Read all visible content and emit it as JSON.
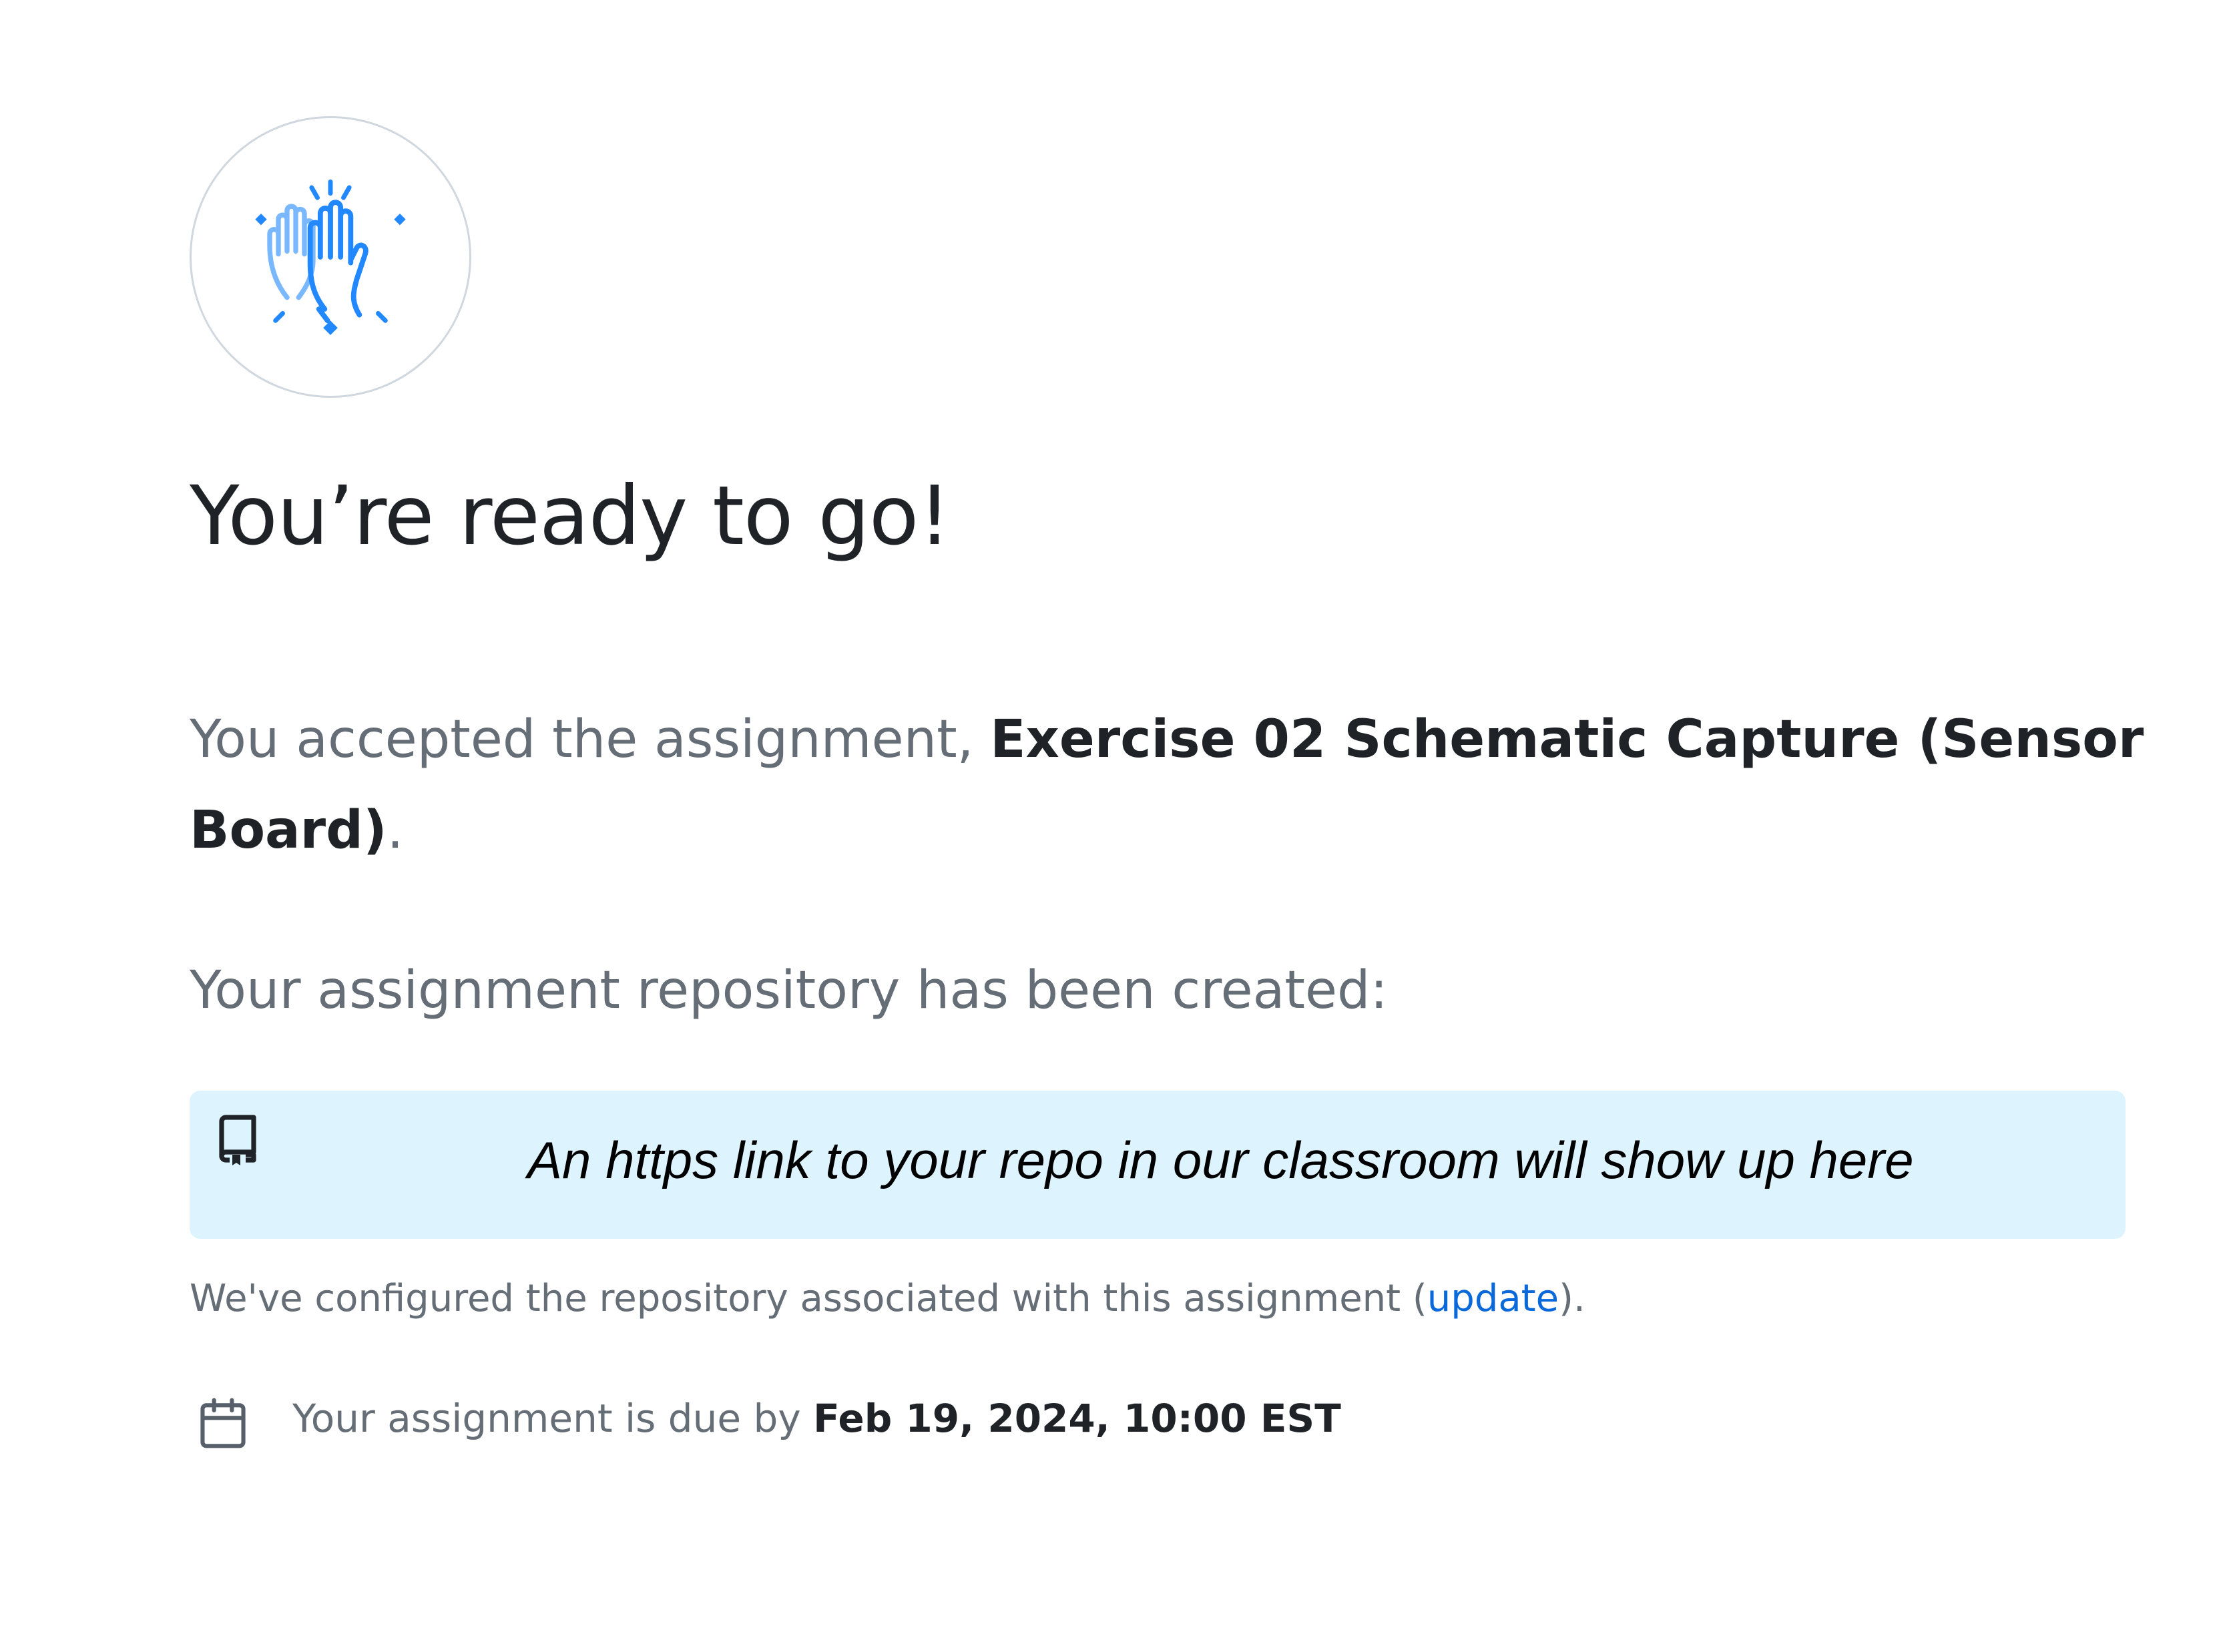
{
  "hero": {
    "icon": "high-five-icon",
    "colors": {
      "primary": "#2188ff",
      "light": "#79b8ff"
    }
  },
  "title": "You’re ready to go!",
  "accepted": {
    "prefix": "You accepted the assignment, ",
    "assignment_name": "Exercise 02 Schematic Capture (Sensor Board)",
    "suffix": "."
  },
  "repository": {
    "created_text": "Your assignment repository has been created:",
    "icon": "repo-icon",
    "link_text": "An https link to your repo in our classroom will show up here",
    "box_color": "#ddf4ff"
  },
  "configured": {
    "prefix": "We've configured the repository associated with this assignment (",
    "link_label": "update",
    "suffix": ").",
    "link_color": "#0969da"
  },
  "due": {
    "icon": "calendar-icon",
    "prefix": "Your assignment is due by ",
    "date": "Feb 19, 2024, 10:00 EST"
  }
}
